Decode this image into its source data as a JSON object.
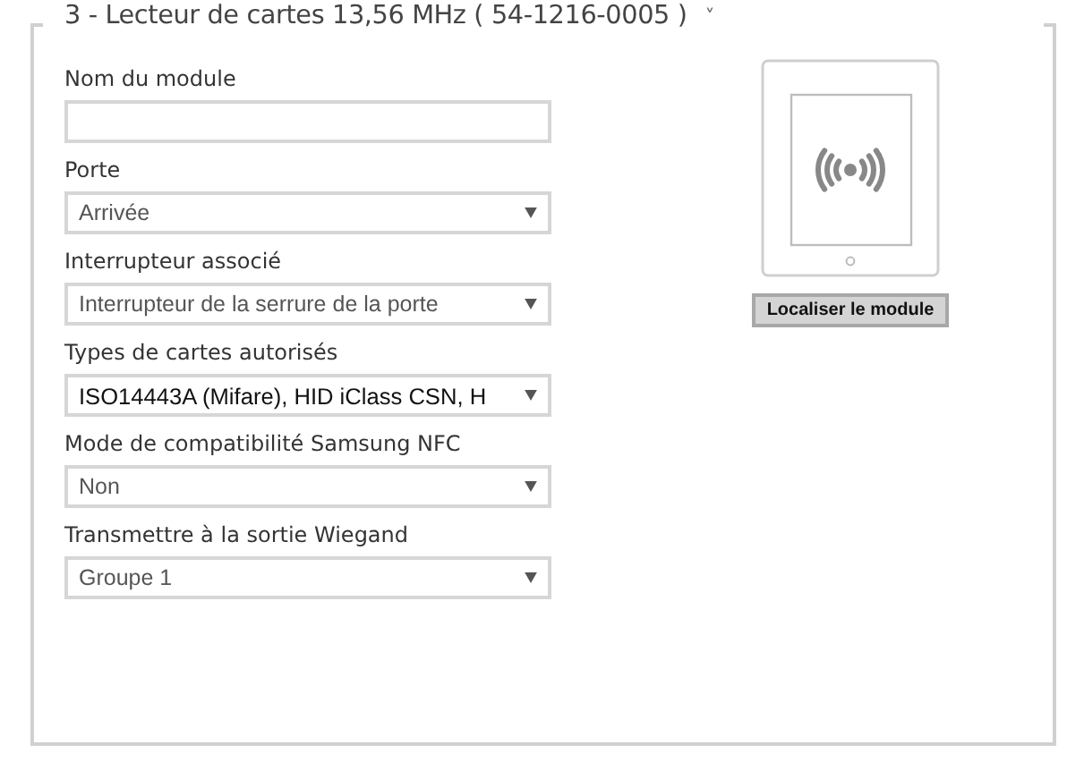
{
  "section": {
    "title": "3 - Lecteur de cartes 13,56 MHz ( 54-1216-0005 )",
    "toggle": "˅"
  },
  "fields": [
    {
      "label": "Nom du module",
      "kind": "input"
    },
    {
      "label": "Porte",
      "kind": "select",
      "value": "Arrivée"
    },
    {
      "label": "Interrupteur associé",
      "kind": "select",
      "value": "Interrupteur de la serrure de la porte"
    },
    {
      "label": "Types de cartes autorisés",
      "kind": "multiselect",
      "value": "ISO14443A (Mifare), HID iClass CSN, H"
    },
    {
      "label": "Mode de compatibilité Samsung NFC",
      "kind": "select",
      "value": "Non"
    },
    {
      "label": "Transmettre à la sortie Wiegand",
      "kind": "select",
      "value": "Groupe 1"
    }
  ],
  "locate_button": "Localiser le module"
}
